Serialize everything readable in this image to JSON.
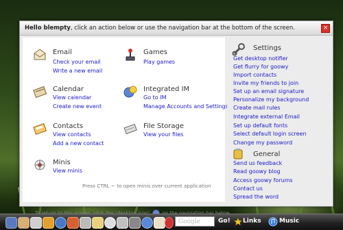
{
  "dialog": {
    "greeting_bold": "Hello blempty",
    "greeting_rest": ", click an action below or use the navigation bar at the bottom of the screen.",
    "close_label": "×"
  },
  "sections": {
    "email": {
      "title": "Email",
      "links": [
        "Check your email",
        "Write a new email"
      ]
    },
    "calendar": {
      "title": "Calendar",
      "links": [
        "View calendar",
        "Create new event"
      ]
    },
    "contacts": {
      "title": "Contacts",
      "links": [
        "View contacts",
        "Add a new contact"
      ]
    },
    "minis": {
      "title": "Minis",
      "links": [
        "View minis"
      ],
      "hint": "Press CTRL ~ to open minis over current application"
    },
    "games": {
      "title": "Games",
      "links": [
        "Play games"
      ]
    },
    "im": {
      "title": "Integrated IM",
      "links": [
        "Go to IM",
        "Manage Accounts and Settings"
      ]
    },
    "storage": {
      "title": "File Storage",
      "links": [
        "View your files"
      ]
    }
  },
  "footer": {
    "before": "To return to this screen, click the \"desktop icon\"",
    "after": "on the navigation bar below"
  },
  "settings": {
    "title": "Settings",
    "links": [
      "Get desktop notifier",
      "Get flurry for goowy",
      "Import contacts",
      "Invite my friends to join",
      "Set up an email signature",
      "Personalize my background",
      "Create mail rules",
      "Integrate external Email",
      "Set up default fonts",
      "Select default login screen",
      "Change my password"
    ]
  },
  "general": {
    "title": "General",
    "links": [
      "Send us feedback",
      "Read goowy blog",
      "Access goowy forums",
      "Contact us",
      "Spread the word"
    ]
  },
  "taskbar": {
    "search_placeholder": "Google",
    "go_label": "Go!",
    "links_label": "Links",
    "music_label": "Music",
    "icons": [
      "desktop-icon",
      "mail-icon",
      "calendar-icon",
      "contacts-icon",
      "im-icon",
      "games-icon",
      "storage-icon",
      "feeds-icon",
      "minis-icon",
      "bookmarks-icon",
      "settings-icon",
      "photo-icon",
      "help-icon",
      "logout-icon"
    ]
  }
}
